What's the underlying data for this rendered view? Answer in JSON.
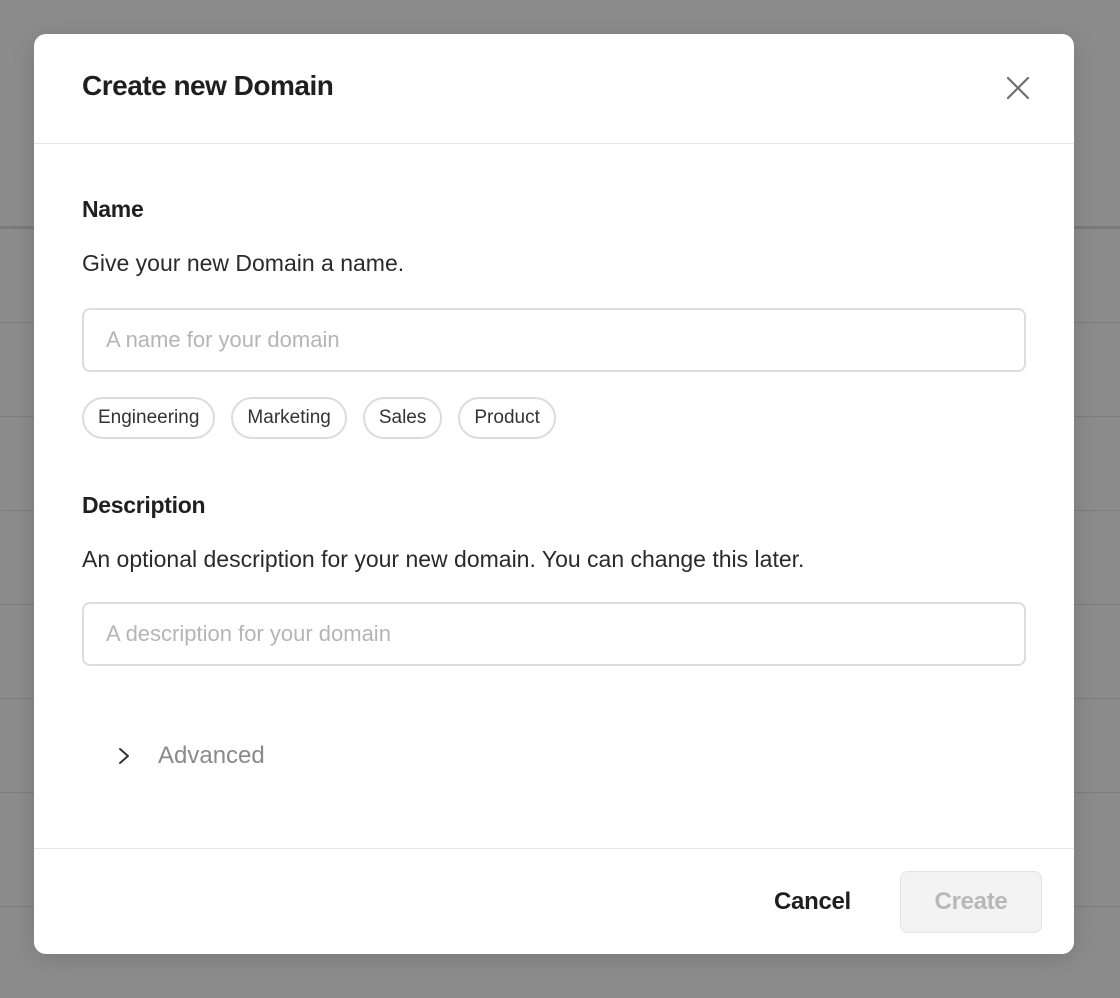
{
  "dialog": {
    "title": "Create new Domain"
  },
  "name_section": {
    "label": "Name",
    "help": "Give your new Domain a name.",
    "input_value": "",
    "placeholder": "A name for your domain",
    "suggestions": [
      "Engineering",
      "Marketing",
      "Sales",
      "Product"
    ]
  },
  "description_section": {
    "label": "Description",
    "help": "An optional description for your new domain. You can change this later.",
    "input_value": "",
    "placeholder": "A description for your domain"
  },
  "advanced": {
    "label": "Advanced",
    "icon": "chevron-right-icon",
    "expanded": false
  },
  "footer": {
    "cancel_label": "Cancel",
    "create_label": "Create",
    "create_disabled": true
  },
  "icons": {
    "close": "close-icon"
  },
  "colors": {
    "overlay": "#8c8c8c",
    "title_text": "#1f1f1f",
    "placeholder_text": "#b5b5b5",
    "muted_text": "#8a8a8a",
    "disabled_button_bg": "#f3f3f3",
    "disabled_button_text": "#b8b8b8"
  }
}
